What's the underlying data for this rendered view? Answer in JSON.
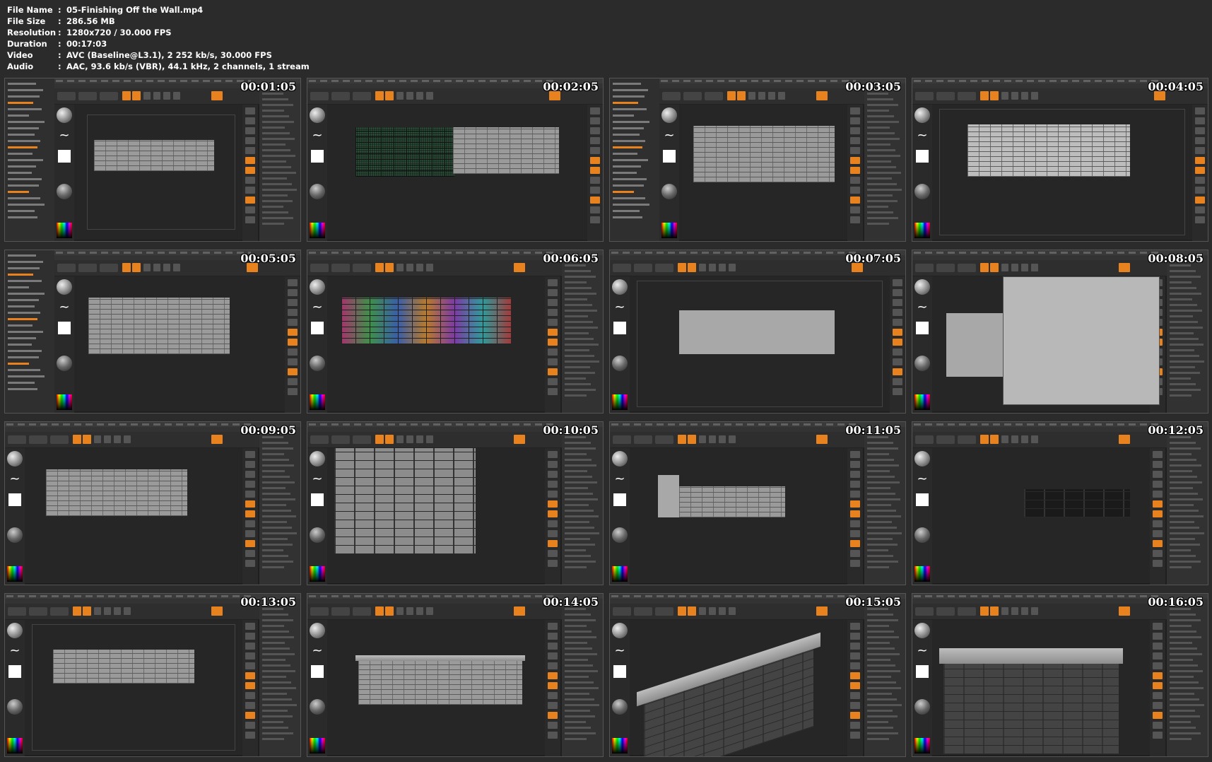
{
  "meta": {
    "file_name_label": "File Name",
    "file_name": "05-Finishing Off the Wall.mp4",
    "file_size_label": "File Size",
    "file_size": "286.56 MB",
    "resolution_label": "Resolution",
    "resolution": "1280x720 / 30.000 FPS",
    "duration_label": "Duration",
    "duration": "00:17:03",
    "video_label": "Video",
    "video": "AVC (Baseline@L3.1), 2 252 kb/s, 30.000 FPS",
    "audio_label": "Audio",
    "audio": "AAC, 93.6 kb/s (VBR), 44.1 kHz, 2 channels, 1 stream",
    "separator": ":"
  },
  "thumbnails": [
    {
      "timestamp": "00:01:05",
      "scene": "brick-wall-flat"
    },
    {
      "timestamp": "00:02:05",
      "scene": "brick-wall-masked"
    },
    {
      "timestamp": "00:03:05",
      "scene": "brick-wall-closeup"
    },
    {
      "timestamp": "00:04:05",
      "scene": "brick-wall-white"
    },
    {
      "timestamp": "00:05:05",
      "scene": "brick-wall-closeup"
    },
    {
      "timestamp": "00:06:05",
      "scene": "brick-wall-polygroups"
    },
    {
      "timestamp": "00:07:05",
      "scene": "flat-slab"
    },
    {
      "timestamp": "00:08:05",
      "scene": "alpha-popup"
    },
    {
      "timestamp": "00:09:05",
      "scene": "brick-wall-perspective"
    },
    {
      "timestamp": "00:10:05",
      "scene": "brick-wall-large"
    },
    {
      "timestamp": "00:11:05",
      "scene": "wall-with-pillar"
    },
    {
      "timestamp": "00:12:05",
      "scene": "gizmo-pillar"
    },
    {
      "timestamp": "00:13:05",
      "scene": "brick-wall-small"
    },
    {
      "timestamp": "00:14:05",
      "scene": "wall-with-cap"
    },
    {
      "timestamp": "00:15:05",
      "scene": "cap-closeup"
    },
    {
      "timestamp": "00:16:05",
      "scene": "cap-closeup-front"
    }
  ],
  "theme": {
    "accent": "#e8821e",
    "background": "#2b2b2b"
  }
}
